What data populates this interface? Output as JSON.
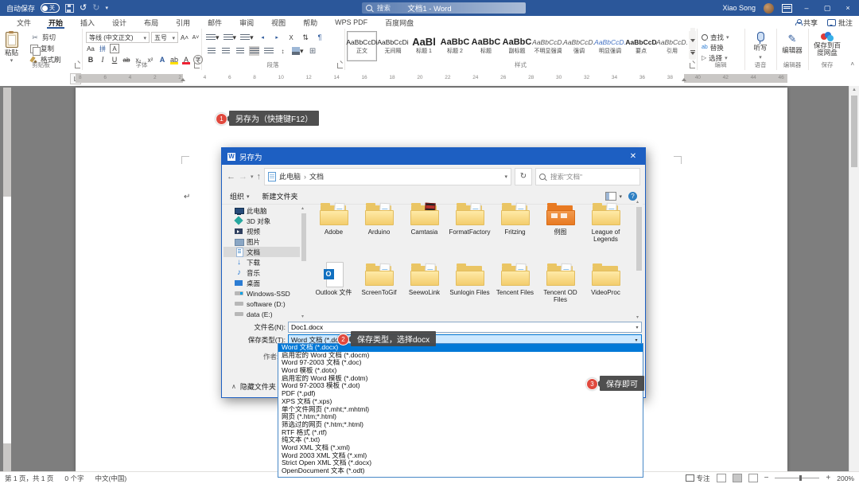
{
  "titlebar": {
    "autosave_label": "自动保存",
    "autosave_state": "关",
    "title": "文档1 - Word",
    "search_placeholder": "搜索",
    "user": "Xiao Song"
  },
  "tabs": [
    {
      "label": "文件"
    },
    {
      "label": "开始",
      "cls": "active"
    },
    {
      "label": "插入"
    },
    {
      "label": "设计"
    },
    {
      "label": "布局"
    },
    {
      "label": "引用"
    },
    {
      "label": "邮件"
    },
    {
      "label": "审阅"
    },
    {
      "label": "视图"
    },
    {
      "label": "帮助"
    },
    {
      "label": "WPS PDF"
    },
    {
      "label": "百度网盘"
    }
  ],
  "tab_actions": {
    "share": "共享",
    "comments": "批注"
  },
  "ribbon": {
    "clipboard": {
      "label": "剪贴板",
      "paste": "粘贴",
      "cut": "剪切",
      "copy": "复制",
      "painter": "格式刷"
    },
    "font": {
      "label": "字体",
      "name": "等线 (中文正文)",
      "size": "五号"
    },
    "paragraph": {
      "label": "段落"
    },
    "styles": {
      "label": "样式",
      "items": [
        {
          "sample": "AaBbCcDi",
          "name": "正文",
          "cls": "sel"
        },
        {
          "sample": "AaBbCcDi",
          "name": "无间隔"
        },
        {
          "sample": "AaBl",
          "name": "标题 1",
          "cls": "big"
        },
        {
          "sample": "AaBbC",
          "name": "标题 2",
          "cls": "med"
        },
        {
          "sample": "AaBbC",
          "name": "标题",
          "cls": "med"
        },
        {
          "sample": "AaBbC",
          "name": "副标题",
          "cls": "med"
        },
        {
          "sample": "AaBbCcD.",
          "name": "不明显强调",
          "cls": "it"
        },
        {
          "sample": "AaBbCcD.",
          "name": "强调",
          "cls": "it"
        },
        {
          "sample": "AaBbCcD.",
          "name": "明显强调",
          "cls": "itblue"
        },
        {
          "sample": "AaBbCcD",
          "name": "要点",
          "cls": "bold"
        },
        {
          "sample": "AaBbCcD.",
          "name": "引用",
          "cls": "it"
        }
      ]
    },
    "edit": {
      "label": "编辑",
      "find": "查找",
      "replace": "替换",
      "select": "选择"
    },
    "voice": {
      "label": "语音",
      "dictate": "听写"
    },
    "editor": {
      "label": "编辑器",
      "editor": "编辑器"
    },
    "save": {
      "label": "保存",
      "to_disk": "保存到百度网盘"
    }
  },
  "ruler_numbers": [
    "8",
    "6",
    "4",
    "2",
    "2",
    "4",
    "6",
    "8",
    "10",
    "12",
    "14",
    "16",
    "18",
    "20",
    "22",
    "24",
    "26",
    "28",
    "30",
    "32",
    "34",
    "36",
    "38",
    "40",
    "42",
    "44",
    "46"
  ],
  "callouts": [
    {
      "num": "1",
      "text": "另存为（快捷键F12）"
    },
    {
      "num": "2",
      "text": "保存类型，选择docx"
    },
    {
      "num": "3",
      "text": "保存即可"
    }
  ],
  "dialog": {
    "title": "另存为",
    "breadcrumb_root": "此电脑",
    "breadcrumb_current": "文档",
    "search_placeholder": "搜索\"文档\"",
    "organize": "组织",
    "new_folder": "新建文件夹",
    "sidebar": [
      {
        "label": "此电脑",
        "icon": "i-pc"
      },
      {
        "label": "3D 对象",
        "icon": "i-3d"
      },
      {
        "label": "视频",
        "icon": "i-video"
      },
      {
        "label": "图片",
        "icon": "i-pic"
      },
      {
        "label": "文档",
        "icon": "i-doc",
        "state": "sel"
      },
      {
        "label": "下载",
        "icon": "i-down"
      },
      {
        "label": "音乐",
        "icon": "i-music"
      },
      {
        "label": "桌面",
        "icon": "i-desk"
      },
      {
        "label": "Windows-SSD",
        "icon": "i-drivewin"
      },
      {
        "label": "software (D:)",
        "icon": "i-drive"
      },
      {
        "label": "data (E:)",
        "icon": "i-drive"
      }
    ],
    "folders": [
      {
        "label": "Adobe",
        "icon": "ffull"
      },
      {
        "label": "Arduino",
        "icon": "ffull"
      },
      {
        "label": "Camtasia",
        "icon": "fcam"
      },
      {
        "label": "FormatFactory",
        "icon": "ffull"
      },
      {
        "label": "Fritzing",
        "icon": "ffull"
      },
      {
        "label": "例图",
        "icon": "forange"
      },
      {
        "label": "League of Legends",
        "icon": "ffull"
      },
      {
        "label": "Outlook 文件",
        "icon": "foutlook"
      },
      {
        "label": "ScreenToGif",
        "icon": "ffull"
      },
      {
        "label": "SeewoLink",
        "icon": "ffull"
      },
      {
        "label": "Sunlogin Files",
        "icon": "fempty"
      },
      {
        "label": "Tencent Files",
        "icon": "ffull"
      },
      {
        "label": "Tencent OD Files",
        "icon": "ffull"
      },
      {
        "label": "VideoProc",
        "icon": "fempty"
      }
    ],
    "filename_label": "文件名(N):",
    "filename_value": "Doc1.docx",
    "savetype_label": "保存类型(T):",
    "savetype_value": "Word 文档 (*.docx)",
    "author_label": "作者:",
    "hide_folders": "隐藏文件夹",
    "type_options": [
      {
        "label": "Word 文档 (*.docx)",
        "state": "sel"
      },
      {
        "label": "启用宏的 Word 文档 (*.docm)"
      },
      {
        "label": "Word 97-2003 文档 (*.doc)"
      },
      {
        "label": "Word 模板 (*.dotx)"
      },
      {
        "label": "启用宏的 Word 模板 (*.dotm)"
      },
      {
        "label": "Word 97-2003 模板 (*.dot)"
      },
      {
        "label": "PDF (*.pdf)"
      },
      {
        "label": "XPS 文档 (*.xps)"
      },
      {
        "label": "单个文件网页 (*.mht;*.mhtml)"
      },
      {
        "label": "网页 (*.htm;*.html)"
      },
      {
        "label": "筛选过的网页 (*.htm;*.html)"
      },
      {
        "label": "RTF 格式 (*.rtf)"
      },
      {
        "label": "纯文本 (*.txt)"
      },
      {
        "label": "Word XML 文档 (*.xml)"
      },
      {
        "label": "Word 2003 XML 文档 (*.xml)"
      },
      {
        "label": "Strict Open XML 文档 (*.docx)"
      },
      {
        "label": "OpenDocument 文本 (*.odt)"
      }
    ]
  },
  "status": {
    "page": "第 1 页，共 1 页",
    "words": "0 个字",
    "lang": "中文(中国)",
    "focus": "专注",
    "zoom": "200%"
  },
  "colors": {
    "titlebar_blue": "#2b579a",
    "dialog_titlebar_blue": "#1d5fc2",
    "selection_blue": "#0078d7",
    "callout_red": "#e0493e"
  }
}
